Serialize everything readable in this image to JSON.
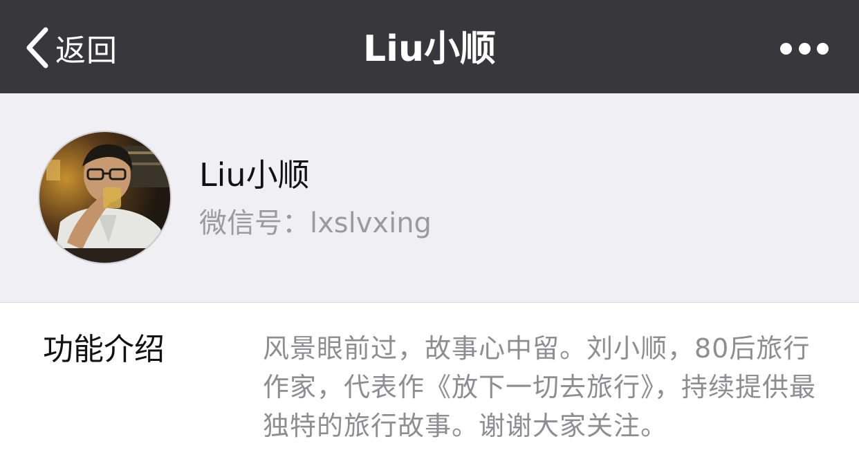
{
  "navbar": {
    "back_label": "返回",
    "title": "Liu小顺",
    "more_icon": "more-horizontal-icon",
    "back_icon": "chevron-left-icon"
  },
  "profile": {
    "name": "Liu小顺",
    "wechat_id": "微信号：lxslvxing"
  },
  "intro": {
    "label": "功能介绍",
    "text": "风景眼前过，故事心中留。刘小顺，80后旅行作家，代表作《放下一切去旅行》，持续提供最独特的旅行故事。谢谢大家关注。"
  },
  "colors": {
    "navbar_bg": "#38373c",
    "profile_bg": "#efeff4",
    "secondary_text": "#9a9a9f"
  }
}
